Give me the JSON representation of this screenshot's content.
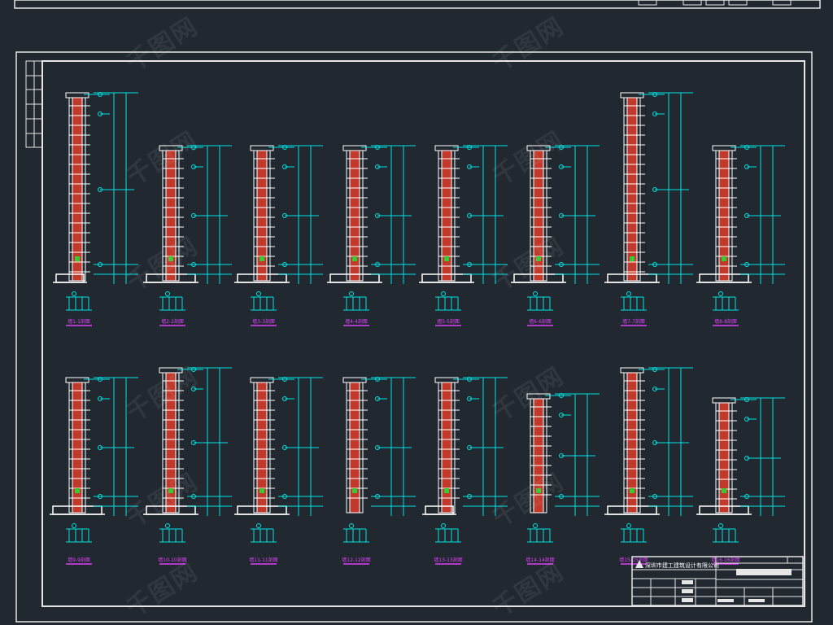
{
  "watermark": {
    "text": "千图网",
    "color": "#ffffff"
  },
  "drawing": {
    "colors": {
      "background": "#212830",
      "frame": "#e6e6e6",
      "dimension": "#00e5e5",
      "wall_fill": "#c0392b",
      "rebar": "#ffffff",
      "label": "#e040fb",
      "accent_green": "#33cc33"
    },
    "sections": [
      {
        "label": "墙1-1剖面",
        "tall": "full",
        "foot": "left"
      },
      {
        "label": "墙2-2剖面",
        "tall": "mid",
        "foot": "both"
      },
      {
        "label": "墙3-3剖面",
        "tall": "mid",
        "foot": "both"
      },
      {
        "label": "墙4-4剖面",
        "tall": "mid",
        "foot": "both"
      },
      {
        "label": "墙5-5剖面",
        "tall": "mid",
        "foot": "both"
      },
      {
        "label": "墙6-6剖面",
        "tall": "mid",
        "foot": "both"
      },
      {
        "label": "墙7-7剖面",
        "tall": "full",
        "foot": "both"
      },
      {
        "label": "墙8-8剖面",
        "tall": "mid",
        "foot": "both"
      },
      {
        "label": "墙9-9剖面",
        "tall": "low",
        "foot": "both"
      },
      {
        "label": "墙10-10剖面",
        "tall": "low",
        "foot": "both"
      },
      {
        "label": "墙11-11剖面",
        "tall": "low",
        "foot": "both"
      },
      {
        "label": "墙12-12剖面",
        "tall": "low",
        "foot": "none"
      },
      {
        "label": "墙13-13剖面",
        "tall": "low",
        "foot": "left"
      },
      {
        "label": "墙14-14剖面",
        "tall": "low",
        "foot": "none"
      },
      {
        "label": "墙15-15剖面",
        "tall": "low",
        "foot": "both"
      },
      {
        "label": "墙16-16剖面",
        "tall": "short",
        "foot": "both"
      }
    ]
  },
  "title_block": {
    "company": "深圳市建工建筑设计有限公司",
    "drawing_title": "墙身大样图",
    "rows": [
      "工程名称",
      "设计",
      "校对",
      "审核"
    ]
  }
}
